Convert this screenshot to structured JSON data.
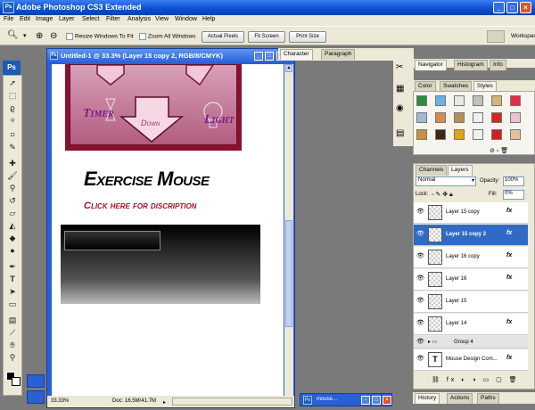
{
  "app": {
    "title": "Adobe Photoshop CS3 Extended"
  },
  "menu": [
    "File",
    "Edit",
    "Image",
    "Layer",
    "Select",
    "Filter",
    "Analysis",
    "View",
    "Window",
    "Help"
  ],
  "options": {
    "resize_windows": "Resize Windows To Fit",
    "zoom_all": "Zoom All Windows",
    "actual_pixels": "Actual Pixels",
    "fit_screen": "Fit Screen",
    "print_size": "Print Size",
    "workspace": "Workspace"
  },
  "ps_badge": "Ps",
  "document": {
    "title": "Untitled-1 @ 33.3% (Layer 15 copy 2, RGB/8/CMYK)",
    "zoom": "33.33%",
    "doc_size": "Doc: 16.5M/41.7M",
    "canvas": {
      "labels": {
        "timer": "Timer",
        "down": "Down",
        "light": "Light"
      },
      "heading": "Exercise Mouse",
      "subheading": "Click here for discription"
    }
  },
  "panels": {
    "character_tabs": [
      "Character",
      "Paragraph"
    ],
    "nav_tabs": [
      "Navigator",
      "Histogram",
      "Info"
    ],
    "style_tabs": [
      "Color",
      "Swatches",
      "Styles"
    ],
    "layers_tabs": [
      "Channels",
      "Layers"
    ],
    "blend_mode": "Normal",
    "opacity_label": "Opacity:",
    "opacity": "100%",
    "lock_label": "Lock:",
    "fill_label": "Fill:",
    "fill": "0%",
    "history_tabs": [
      "History",
      "Actions",
      "Paths"
    ]
  },
  "layers": [
    {
      "name": "Layer 15 copy",
      "fx": "fx"
    },
    {
      "name": "Layer 15 copy 2",
      "fx": "fx"
    },
    {
      "name": "Layer 16 copy",
      "fx": "fx"
    },
    {
      "name": "Layer 16",
      "fx": "fx"
    },
    {
      "name": "Layer 15",
      "fx": ""
    },
    {
      "name": "Layer 14",
      "fx": "fx"
    },
    {
      "name": "Group 4",
      "fx": ""
    },
    {
      "name": "Mouse Design Com...",
      "fx": "fx"
    }
  ],
  "taskbar": {
    "minimized_doc": "mouse..."
  },
  "colors": {
    "accent": "#316ac5",
    "panel_bg": "#ece9d8",
    "title_blue": "#2a5fd6",
    "canvas_maroon": "#8a1030",
    "canvas_pink": "#c86f91"
  }
}
